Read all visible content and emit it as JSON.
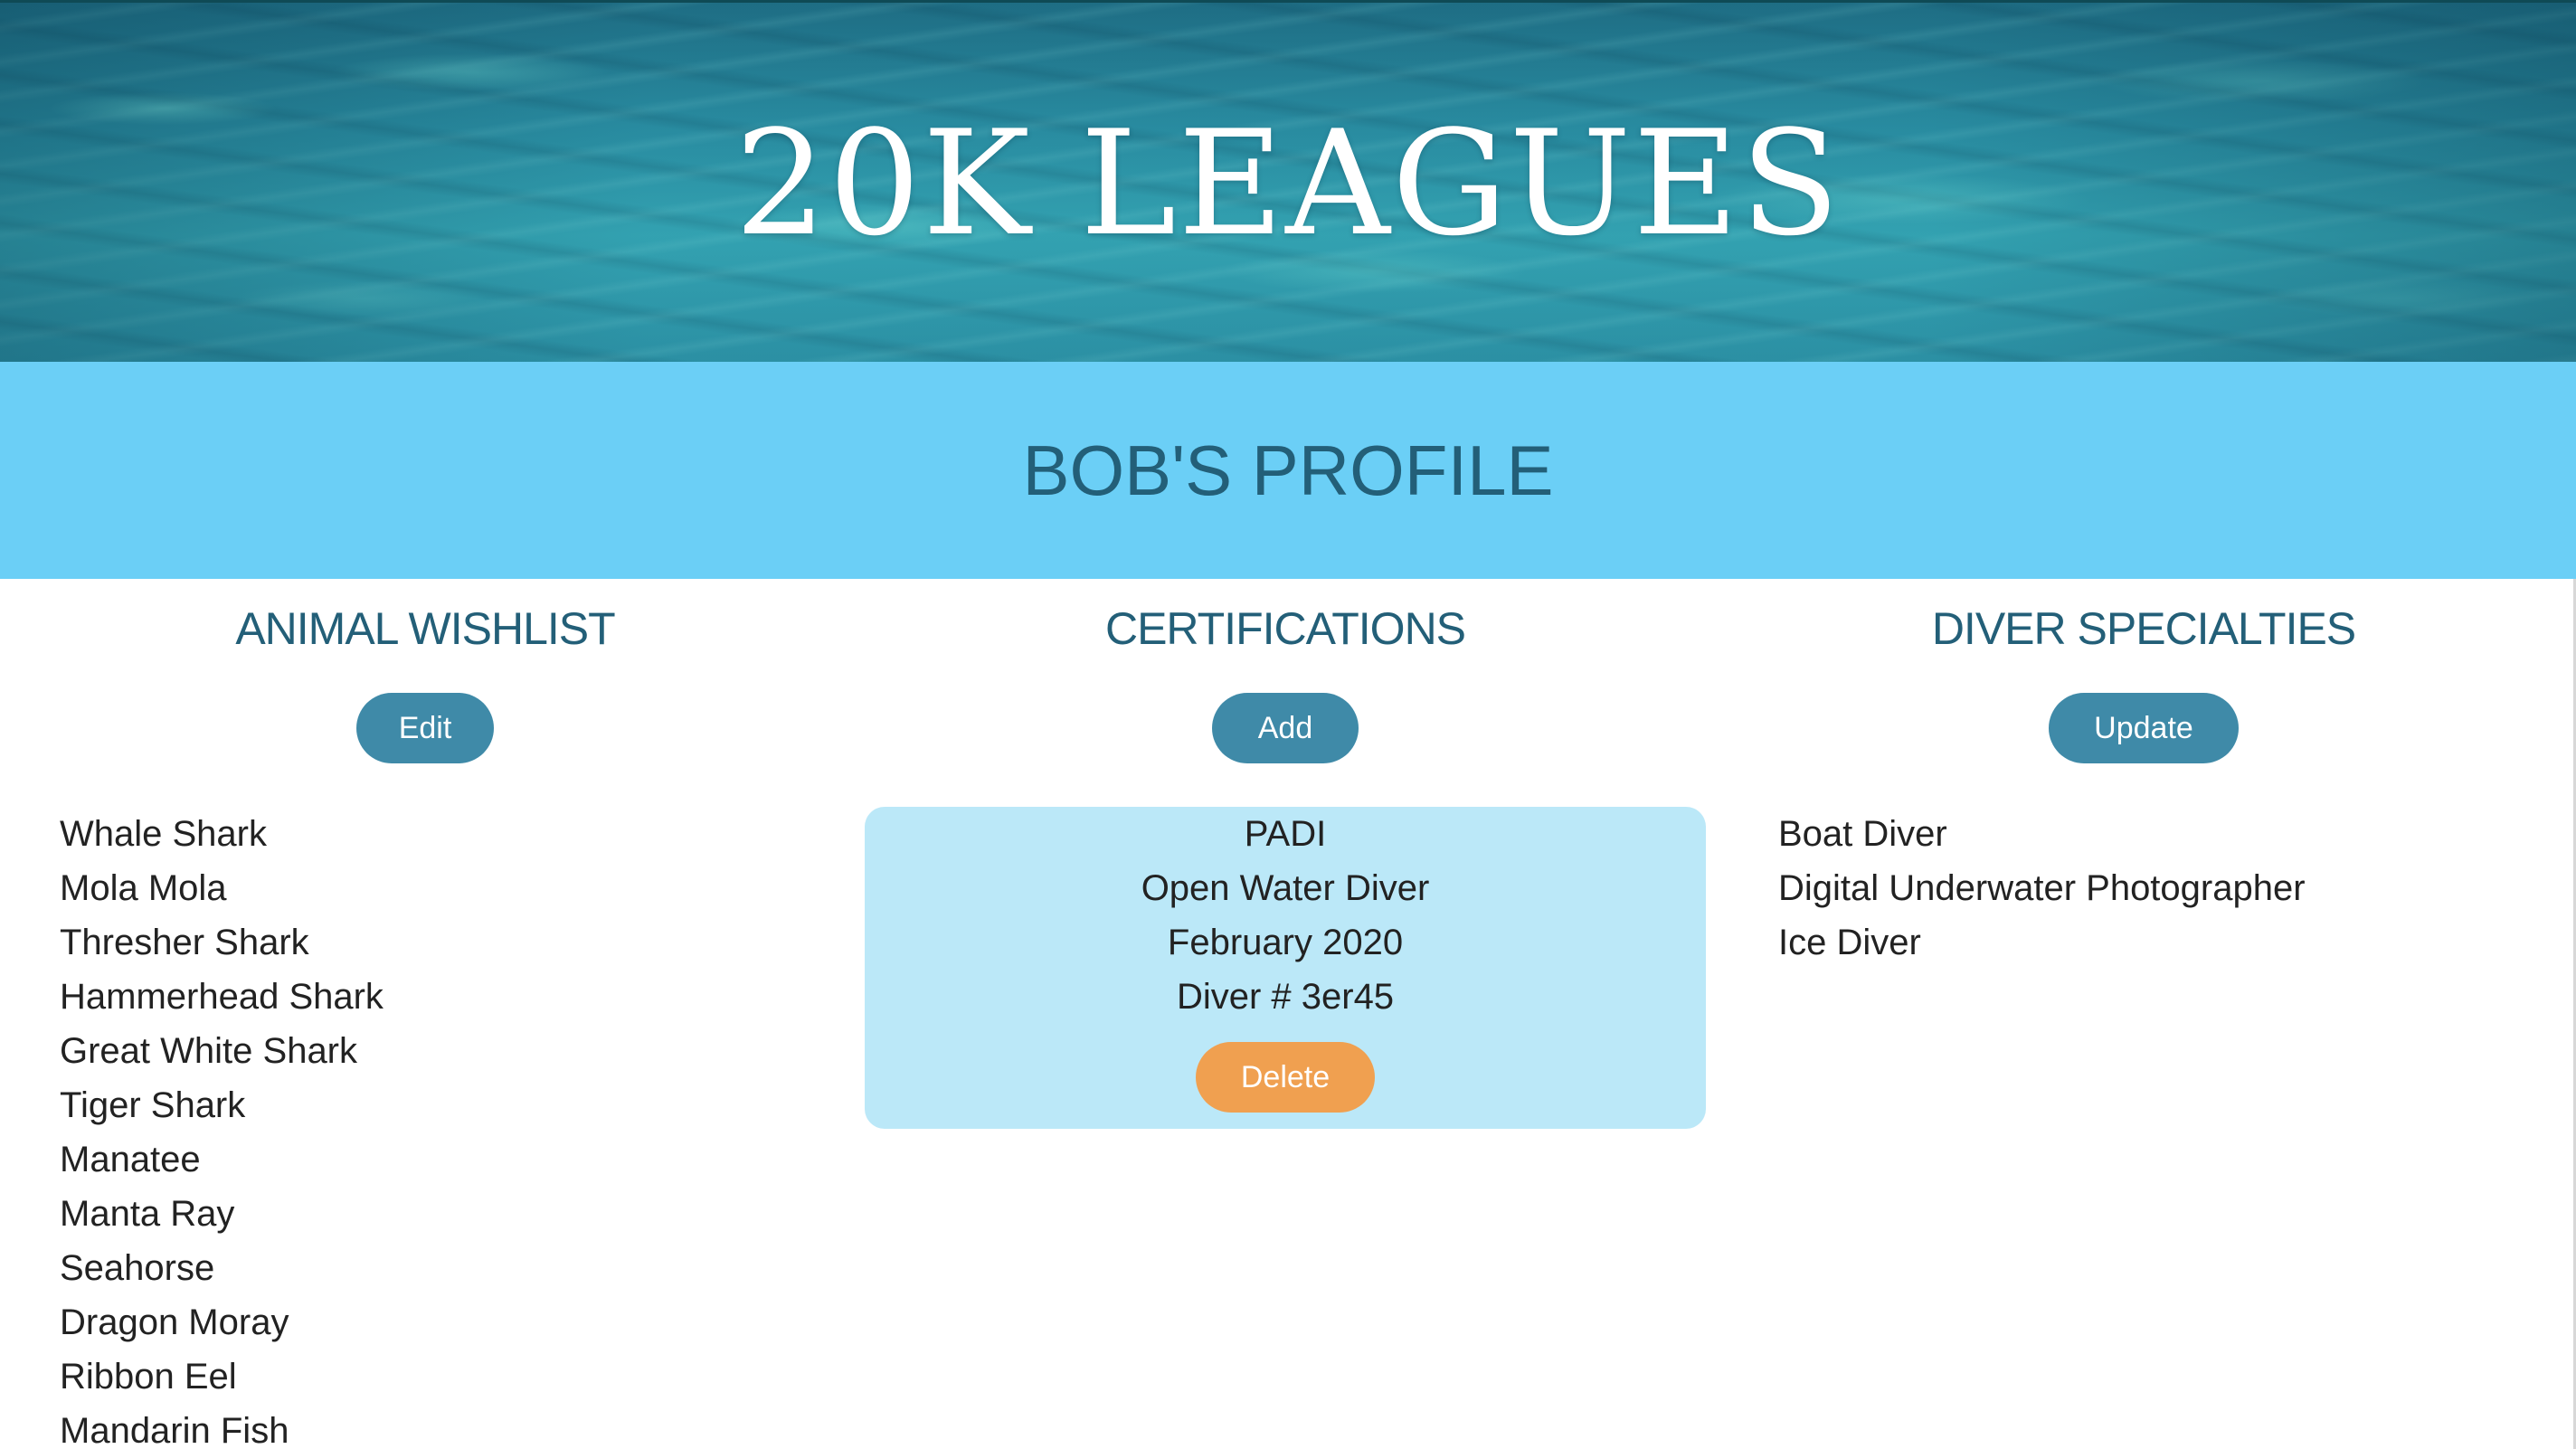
{
  "header": {
    "site_title": "20K LEAGUES"
  },
  "profile": {
    "title": "BOB'S PROFILE"
  },
  "wishlist": {
    "heading": "ANIMAL WISHLIST",
    "button_label": "Edit",
    "items": [
      "Whale Shark",
      "Mola Mola",
      "Thresher Shark",
      "Hammerhead Shark",
      "Great White Shark",
      "Tiger Shark",
      "Manatee",
      "Manta Ray",
      "Seahorse",
      "Dragon Moray",
      "Ribbon Eel",
      "Mandarin Fish"
    ]
  },
  "certifications": {
    "heading": "CERTIFICATIONS",
    "button_label": "Add",
    "cards": [
      {
        "agency": "PADI",
        "level": "Open Water Diver",
        "date": "February 2020",
        "diver_number": "Diver # 3er45",
        "delete_label": "Delete"
      }
    ]
  },
  "specialties": {
    "heading": "DIVER SPECIALTIES",
    "button_label": "Update",
    "items": [
      "Boat Diver",
      "Digital Underwater Photographer",
      "Ice Diver"
    ]
  },
  "colors": {
    "profile_band": "#6bcff6",
    "heading_text": "#235f78",
    "primary_button": "#3f8aa8",
    "delete_button": "#f0a050",
    "card_background": "#bbe8f8"
  }
}
